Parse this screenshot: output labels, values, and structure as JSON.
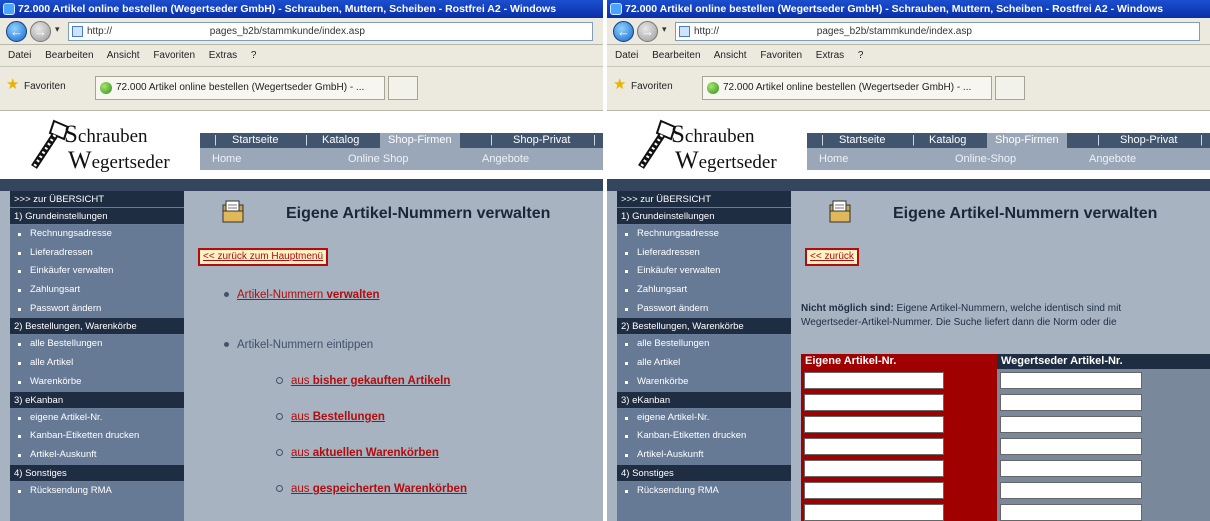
{
  "browser": {
    "window_title": "72.000 Artikel online bestellen (Wegertseder GmbH) - Schrauben, Muttern, Scheiben - Rostfrei A2 - Windows",
    "url_prefix": "http://",
    "url_path": "pages_b2b/stammkunde/index.asp",
    "menu": [
      "Datei",
      "Bearbeiten",
      "Ansicht",
      "Favoriten",
      "Extras",
      "?"
    ],
    "favorites_label": "Favoriten",
    "tab_title": "72.000 Artikel online bestellen (Wegertseder GmbH) - ..."
  },
  "site": {
    "logo_line1_initial": "S",
    "logo_line1_rest": "chrauben",
    "logo_line2_initial": "W",
    "logo_line2_rest": "egertseder",
    "nav_top": [
      "Startseite",
      "Katalog",
      "Shop-Firmen",
      "Shop-Privat"
    ],
    "nav_sub": [
      "Home",
      "Online Shop",
      "Angebote"
    ],
    "nav_sub_right": [
      "Home",
      "Online-Shop",
      "Angebote"
    ]
  },
  "sidebar": {
    "items": [
      {
        "type": "head",
        "label": ">>> zur ÜBERSICHT"
      },
      {
        "type": "head",
        "label": "1)  Grundeinstellungen"
      },
      {
        "type": "sub",
        "label": "Rechnungsadresse"
      },
      {
        "type": "sub",
        "label": "Lieferadressen"
      },
      {
        "type": "sub",
        "label": "Einkäufer verwalten"
      },
      {
        "type": "sub",
        "label": "Zahlungsart"
      },
      {
        "type": "sub",
        "label": "Passwort ändern"
      },
      {
        "type": "head",
        "label": "2)  Bestellungen, Warenkörbe"
      },
      {
        "type": "sub",
        "label": "alle Bestellungen"
      },
      {
        "type": "sub",
        "label": "alle Artikel"
      },
      {
        "type": "sub",
        "label": "Warenkörbe"
      },
      {
        "type": "head",
        "label": "3)  eKanban"
      },
      {
        "type": "sub",
        "label": "eigene Artikel-Nr."
      },
      {
        "type": "sub",
        "label": "Kanban-Etiketten drucken"
      },
      {
        "type": "sub",
        "label": "Artikel-Auskunft"
      },
      {
        "type": "head",
        "label": "4)  Sonstiges"
      },
      {
        "type": "sub",
        "label": "Rücksendung RMA"
      }
    ]
  },
  "left_page": {
    "heading": "Eigene Artikel-Nummern verwalten",
    "back_link": "<< zurück zum Hauptmenü",
    "option_manage_prefix": "Artikel-Nummern ",
    "option_manage_bold": "verwalten",
    "option_type_in": "Artikel-Nummern eintippen",
    "sub_options": [
      {
        "prefix": "aus ",
        "bold": "bisher gekauften Artikeln"
      },
      {
        "prefix": "aus ",
        "bold": "Bestellungen"
      },
      {
        "prefix": "aus ",
        "bold": "aktuellen Warenkörben"
      },
      {
        "prefix": "aus ",
        "bold": "gespeicherten Warenkörben"
      }
    ]
  },
  "right_page": {
    "heading": "Eigene Artikel-Nummern verwalten",
    "back_link": "<< zurück",
    "note_bold": "Nicht möglich sind:",
    "note_line1_rest": " Eigene Artikel-Nummern, welche identisch sind mit",
    "note_line2": "Wegertseder-Artikel-Nummer. Die Suche liefert dann die Norm oder die",
    "table_headers": [
      "Eigene Artikel-Nr.",
      "Wegertseder Artikel-Nr."
    ],
    "rows": [
      {
        "own": "",
        "wegertseder": ""
      },
      {
        "own": "",
        "wegertseder": ""
      },
      {
        "own": "",
        "wegertseder": ""
      },
      {
        "own": "",
        "wegertseder": ""
      },
      {
        "own": "",
        "wegertseder": ""
      },
      {
        "own": "",
        "wegertseder": ""
      },
      {
        "own": "",
        "wegertseder": ""
      }
    ]
  },
  "colors": {
    "accent_red": "#b10d0d",
    "nav_dark": "#41556f",
    "sidebar_bg": "#667a95",
    "content_bg": "#a8b3c2",
    "table_red": "#a00000"
  }
}
